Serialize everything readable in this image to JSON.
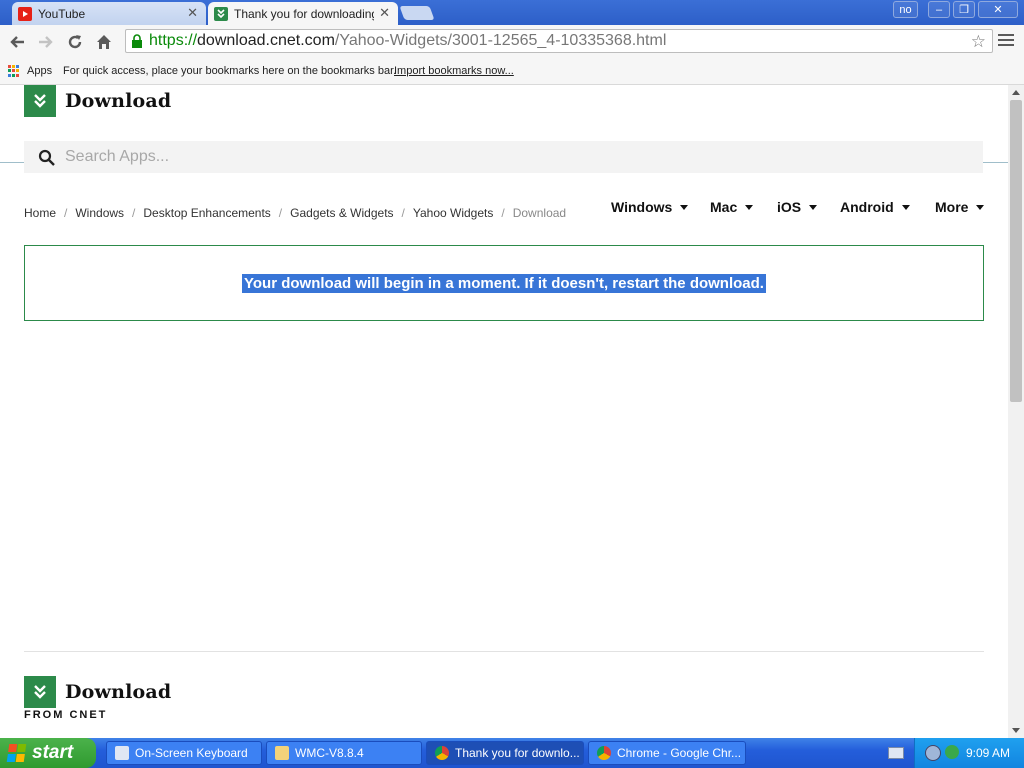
{
  "browser": {
    "tabs": [
      {
        "title": "YouTube",
        "active": false,
        "favicon": "youtube-icon"
      },
      {
        "title": "Thank you for downloading Y",
        "active": true,
        "favicon": "download-icon"
      }
    ],
    "window_controls": {
      "profile_label": "no"
    },
    "url": {
      "scheme": "https://",
      "host": "download.cnet.com",
      "path": "/Yahoo-Widgets/3001-12565_4-10335368.html"
    },
    "bookmarks": {
      "apps_label": "Apps",
      "hint": "For quick access, place your bookmarks here on the bookmarks bar.",
      "import_link": "Import bookmarks now..."
    }
  },
  "page": {
    "logo_text": "Download",
    "search_placeholder": "Search Apps...",
    "breadcrumb": [
      {
        "label": "Home"
      },
      {
        "label": "Windows"
      },
      {
        "label": "Desktop Enhancements"
      },
      {
        "label": "Gadgets & Widgets"
      },
      {
        "label": "Yahoo Widgets"
      },
      {
        "label": "Download",
        "current": true
      }
    ],
    "nav": [
      "Windows",
      "Mac",
      "iOS",
      "Android",
      "More"
    ],
    "notice": "Your download will begin in a moment. If it doesn't, restart the download.",
    "footer": {
      "logo_text": "Download",
      "tagline": "FROM CNET"
    }
  },
  "taskbar": {
    "start_label": "start",
    "tasks": [
      {
        "label": "On-Screen Keyboard",
        "icon": "keyboard-icon",
        "active": false
      },
      {
        "label": "WMC-V8.8.4",
        "icon": "folder-icon",
        "active": false
      },
      {
        "label": "Thank you for downlo...",
        "icon": "chrome-icon",
        "active": true
      },
      {
        "label": "Chrome - Google Chr...",
        "icon": "chrome-icon",
        "active": false
      }
    ],
    "clock": "9:09 AM"
  },
  "colors": {
    "brand_green": "#2c8a4a",
    "selection_blue": "#3875d7",
    "url_green": "#0a8a0a"
  }
}
